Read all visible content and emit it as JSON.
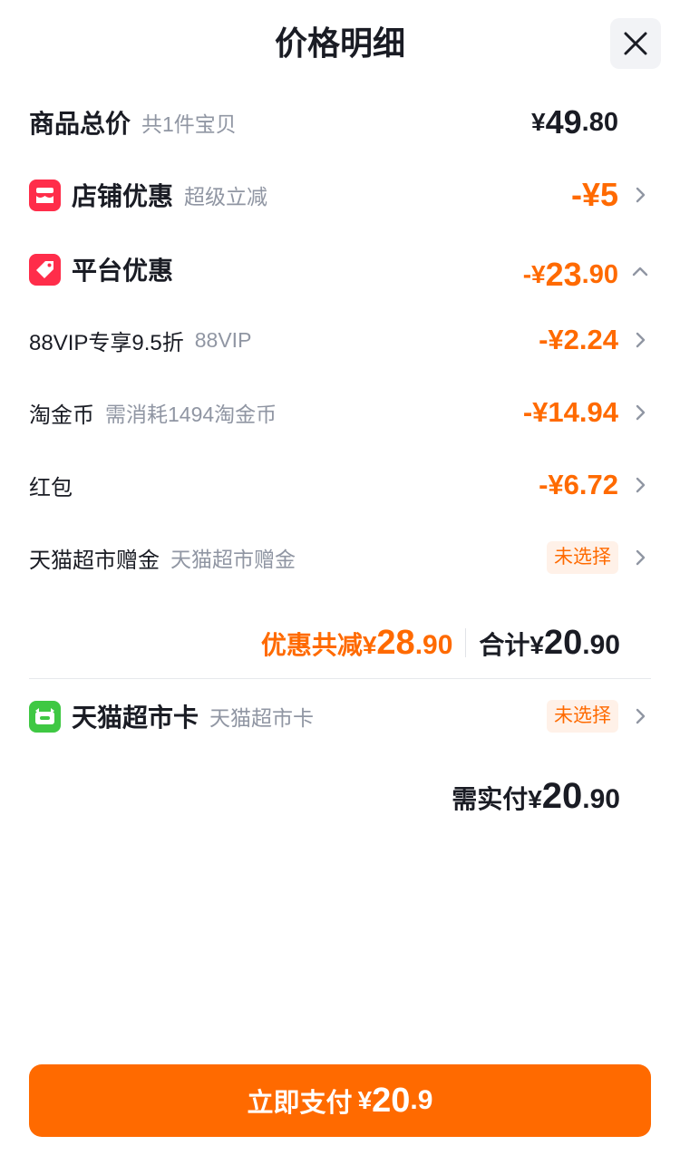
{
  "header": {
    "title": "价格明细",
    "close_icon": "close-icon"
  },
  "rows": {
    "total": {
      "label": "商品总价",
      "note": "共1件宝贝",
      "currency": "¥",
      "int": "49",
      "dec": ".80"
    },
    "store": {
      "label": "店铺优惠",
      "note": "超级立减",
      "amount": "-¥5",
      "icon": "store-discount-icon"
    },
    "platform": {
      "label": "平台优惠",
      "currency": "-¥",
      "int": "23",
      "dec": ".90",
      "icon": "tag-icon"
    },
    "vip": {
      "label": "88VIP专享9.5折",
      "note": "88VIP",
      "amount": "-¥2.24"
    },
    "coins": {
      "label": "淘金币",
      "note": "需消耗1494淘金币",
      "amount": "-¥14.94"
    },
    "redpacket": {
      "label": "红包",
      "amount": "-¥6.72"
    },
    "tmall_gift": {
      "label": "天猫超市赠金",
      "note": "天猫超市赠金",
      "tag": "未选择"
    },
    "tmall_card": {
      "label": "天猫超市卡",
      "note": "天猫超市卡",
      "tag": "未选择",
      "icon": "card-icon"
    }
  },
  "summary": {
    "savings_label": "优惠共减",
    "savings_currency": "¥",
    "savings_int": "28",
    "savings_dec": ".90",
    "total_label": "合计",
    "total_currency": "¥",
    "total_int": "20",
    "total_dec": ".90"
  },
  "payable": {
    "label": "需实付",
    "currency": "¥",
    "int": "20",
    "dec": ".90"
  },
  "pay_button": {
    "label": "立即支付",
    "currency": "¥",
    "int": "20",
    "dec": ".9"
  },
  "colors": {
    "accent": "#ff6a00",
    "text": "#1a1c24",
    "muted": "#9096a3",
    "tag_bg": "#fff1e8"
  }
}
